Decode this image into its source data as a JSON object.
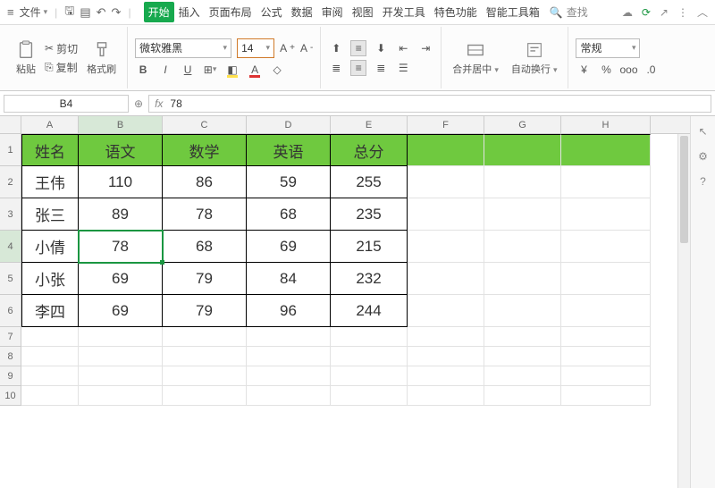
{
  "menu": {
    "file": "文件",
    "tabs": [
      "开始",
      "插入",
      "页面布局",
      "公式",
      "数据",
      "审阅",
      "视图",
      "开发工具",
      "特色功能",
      "智能工具箱"
    ],
    "search": "查找"
  },
  "ribbon": {
    "cut": "剪切",
    "copy": "复制",
    "fmtpainter": "格式刷",
    "paste": "粘贴",
    "font": "微软雅黑",
    "size": "14",
    "merge": "合并居中",
    "wrap": "自动换行",
    "numfmt": "常规"
  },
  "namebox": "B4",
  "formula": "78",
  "cols": [
    "A",
    "B",
    "C",
    "D",
    "E",
    "F",
    "G",
    "H"
  ],
  "selectedCol": "B",
  "selectedRow": 4,
  "table": {
    "header": [
      "姓名",
      "语文",
      "数学",
      "英语",
      "总分"
    ],
    "rows": [
      [
        "王伟",
        "110",
        "86",
        "59",
        "255"
      ],
      [
        "张三",
        "89",
        "78",
        "68",
        "235"
      ],
      [
        "小倩",
        "78",
        "68",
        "69",
        "215"
      ],
      [
        "小张",
        "69",
        "79",
        "84",
        "232"
      ],
      [
        "李四",
        "69",
        "79",
        "96",
        "244"
      ]
    ]
  },
  "chart_data": {
    "type": "table",
    "columns": [
      "姓名",
      "语文",
      "数学",
      "英语",
      "总分"
    ],
    "rows": [
      {
        "姓名": "王伟",
        "语文": 110,
        "数学": 86,
        "英语": 59,
        "总分": 255
      },
      {
        "姓名": "张三",
        "语文": 89,
        "数学": 78,
        "英语": 68,
        "总分": 235
      },
      {
        "姓名": "小倩",
        "语文": 78,
        "数学": 68,
        "英语": 69,
        "总分": 215
      },
      {
        "姓名": "小张",
        "语文": 69,
        "数学": 79,
        "英语": 84,
        "总分": 232
      },
      {
        "姓名": "李四",
        "语文": 69,
        "数学": 79,
        "英语": 96,
        "总分": 244
      }
    ]
  }
}
